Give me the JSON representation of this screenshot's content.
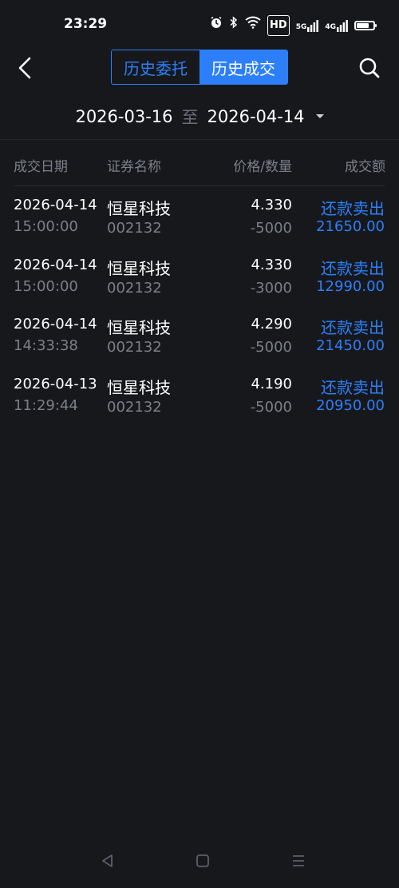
{
  "status_bar": {
    "time": "23:29",
    "icons": [
      "alarm-icon",
      "bluetooth-icon",
      "wifi-icon",
      "hd-icon",
      "signal-5g-icon",
      "signal-4g-icon",
      "battery-icon"
    ],
    "hd_label": "HD",
    "sig1_label": "5G",
    "sig2_label": "4G",
    "battery_level": 0.75
  },
  "nav": {
    "tabs": [
      {
        "label": "历史委托",
        "active": false
      },
      {
        "label": "历史成交",
        "active": true
      }
    ]
  },
  "date_range": {
    "start": "2026-03-16",
    "separator": "至",
    "end": "2026-04-14"
  },
  "table": {
    "headers": {
      "date": "成交日期",
      "name": "证券名称",
      "price_qty": "价格/数量",
      "amount": "成交额"
    },
    "rows": [
      {
        "date": "2026-04-14",
        "time": "15:00:00",
        "name": "恒星科技",
        "code": "002132",
        "price": "4.330",
        "qty": "-5000",
        "type": "还款卖出",
        "amount": "21650.00"
      },
      {
        "date": "2026-04-14",
        "time": "15:00:00",
        "name": "恒星科技",
        "code": "002132",
        "price": "4.330",
        "qty": "-3000",
        "type": "还款卖出",
        "amount": "12990.00"
      },
      {
        "date": "2026-04-14",
        "time": "14:33:38",
        "name": "恒星科技",
        "code": "002132",
        "price": "4.290",
        "qty": "-5000",
        "type": "还款卖出",
        "amount": "21450.00"
      },
      {
        "date": "2026-04-13",
        "time": "11:29:44",
        "name": "恒星科技",
        "code": "002132",
        "price": "4.190",
        "qty": "-5000",
        "type": "还款卖出",
        "amount": "20950.00"
      }
    ]
  },
  "colors": {
    "background": "#17181c",
    "accent": "#2d7ff9",
    "muted": "#7c7f87",
    "text": "#ffffff"
  }
}
